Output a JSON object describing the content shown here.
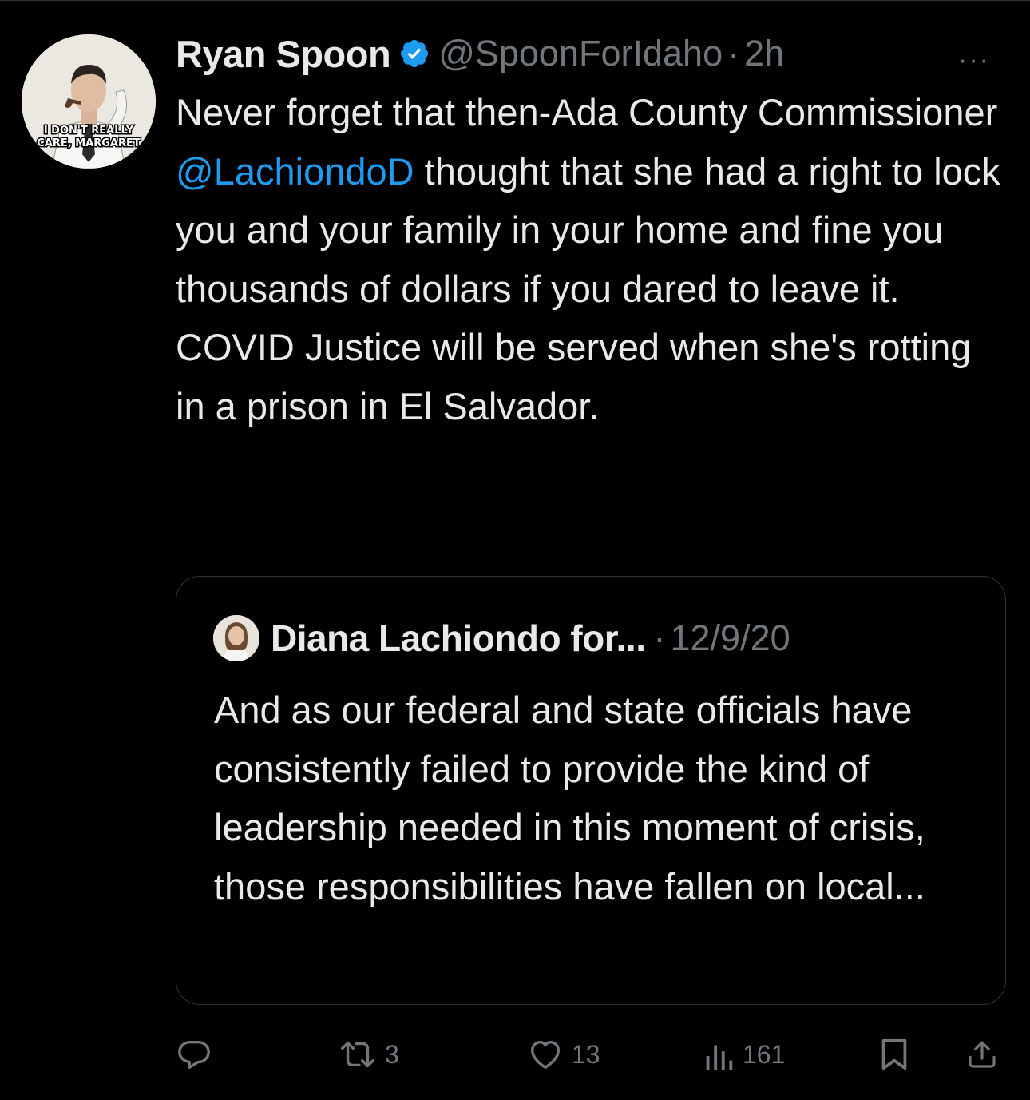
{
  "tweet": {
    "author": {
      "display_name": "Ryan Spoon",
      "handle": "@SpoonForIdaho",
      "verified": true,
      "avatar_caption_line1": "I DON'T REALLY",
      "avatar_caption_line2": "CARE, MARGARET"
    },
    "separator": "·",
    "timestamp": "2h",
    "more_icon": "···",
    "text_before_mention": "Never forget that then-Ada County Commissioner ",
    "mention": "@LachiondoD",
    "text_after_mention": " thought that she had a right to lock you and your family in your home and fine you thousands of dollars if you dared to leave it. COVID Justice will be served when she's rotting in a prison in El Salvador."
  },
  "quote": {
    "display_name": "Diana Lachiondo for...",
    "separator": "·",
    "date": "12/9/20",
    "text": "And as our federal and state officials have consistently failed to provide the kind of leadership needed in this moment of crisis, those responsibilities have fallen on local..."
  },
  "actions": {
    "reply": {
      "icon": "reply-icon",
      "count": ""
    },
    "retweet": {
      "icon": "retweet-icon",
      "count": "3"
    },
    "like": {
      "icon": "heart-icon",
      "count": "13"
    },
    "views": {
      "icon": "views-icon",
      "count": "161"
    },
    "bookmark": {
      "icon": "bookmark-icon"
    },
    "share": {
      "icon": "share-icon"
    }
  },
  "colors": {
    "background": "#000000",
    "text_primary": "#e7e9ea",
    "text_secondary": "#71767b",
    "accent": "#1d9bf0",
    "border": "#2f3336"
  }
}
